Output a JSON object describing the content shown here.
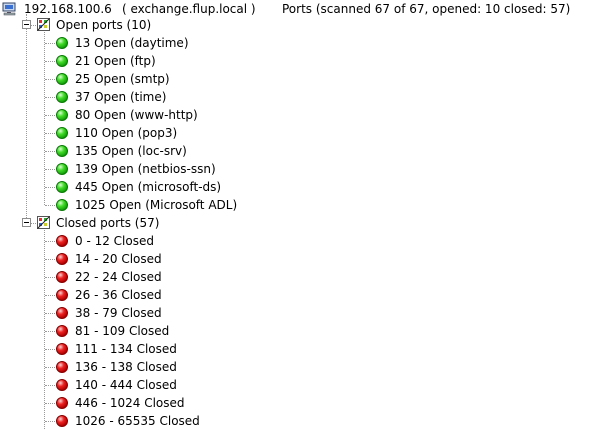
{
  "host": {
    "ip": "192.168.100.6",
    "hostname": "( exchange.flup.local )",
    "summary": "Ports (scanned 67 of 67, opened: 10 closed: 57)",
    "icon": "computer-icon"
  },
  "open_group": {
    "label": "Open ports (10)",
    "icon": "ports-folder-icon",
    "items": [
      {
        "label": "13 Open (daytime)"
      },
      {
        "label": "21 Open (ftp)"
      },
      {
        "label": "25 Open (smtp)"
      },
      {
        "label": "37 Open (time)"
      },
      {
        "label": "80 Open (www-http)"
      },
      {
        "label": "110 Open (pop3)"
      },
      {
        "label": "135 Open (loc-srv)"
      },
      {
        "label": "139 Open (netbios-ssn)"
      },
      {
        "label": "445 Open (microsoft-ds)"
      },
      {
        "label": "1025 Open (Microsoft ADL)"
      }
    ]
  },
  "closed_group": {
    "label": "Closed ports (57)",
    "icon": "ports-folder-icon",
    "items": [
      {
        "label": "0 - 12 Closed"
      },
      {
        "label": "14 - 20 Closed"
      },
      {
        "label": "22 - 24 Closed"
      },
      {
        "label": "26 - 36 Closed"
      },
      {
        "label": "38 - 79 Closed"
      },
      {
        "label": "81 - 109 Closed"
      },
      {
        "label": "111 - 134 Closed"
      },
      {
        "label": "136 - 138 Closed"
      },
      {
        "label": "140 - 444 Closed"
      },
      {
        "label": "446 - 1024 Closed"
      },
      {
        "label": "1026 - 65535 Closed"
      }
    ]
  },
  "colors": {
    "open": "#22c411",
    "closed": "#cc0000",
    "tree_lines": "#9a9a9a"
  }
}
